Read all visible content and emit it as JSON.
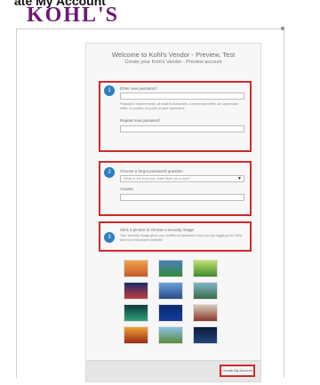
{
  "header": {
    "caption": "ate My Account",
    "logo": "KOHL'S"
  },
  "panel": {
    "welcome": "Welcome to Kohl's Vendor - Preview, Test",
    "subtitle": "Create your Kohl's Vendor - Preview account",
    "sections": [
      {
        "step": "1",
        "label": "Enter new password",
        "note": "Password requirements: at least 8 characters, a lowercase letter, an uppercase letter, a number, no parts of your username",
        "repeat_label": "Repeat new password"
      },
      {
        "step": "2",
        "label": "Choose a forgot password question",
        "select_value": "What is the food you least liked as a child?",
        "answer_label": "Answer"
      },
      {
        "step": "3",
        "label": "Click a picture to choose a security image",
        "note": "Your security image gives you additional assurance that you are logging into Okta, and not a fraudulent website."
      }
    ],
    "create_button": "Create My Account"
  }
}
